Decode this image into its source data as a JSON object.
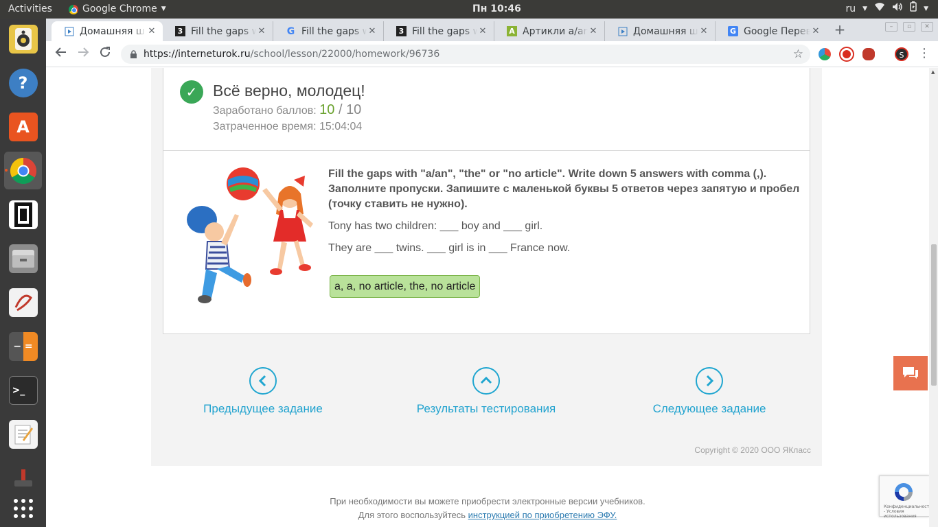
{
  "topbar": {
    "activities": "Activities",
    "app_name": "Google Chrome",
    "clock": "Пн 10:46",
    "keyboard_layout": "ru"
  },
  "dock": {
    "items": [
      {
        "name": "rhythmbox-icon",
        "color": "#e8c547"
      },
      {
        "name": "help-icon",
        "color": "#3d7fc4"
      },
      {
        "name": "software-center-icon",
        "color": "#e95420"
      },
      {
        "name": "chrome-icon",
        "color": "#4285f4"
      },
      {
        "name": "chess-icon",
        "color": "#111111"
      },
      {
        "name": "files-icon",
        "color": "#8d8d8d"
      },
      {
        "name": "document-viewer-icon",
        "color": "#eeeeee"
      },
      {
        "name": "calculator-icon",
        "color": "#f08a24"
      },
      {
        "name": "terminal-icon",
        "color": "#2b2b2b"
      },
      {
        "name": "text-editor-icon",
        "color": "#f4f4f4"
      },
      {
        "name": "joystick-icon",
        "color": "#444444"
      },
      {
        "name": "show-apps-icon",
        "color": "#3a3a3a"
      }
    ]
  },
  "tabs": [
    {
      "title": "Домашняя ш",
      "favicon": "play-doc-icon",
      "active": true
    },
    {
      "title": "Fill the gaps w",
      "favicon": "znanija-icon",
      "active": false
    },
    {
      "title": "Fill the gaps w",
      "favicon": "google-icon",
      "active": false
    },
    {
      "title": "Fill the gaps w",
      "favicon": "znanija-icon",
      "active": false
    },
    {
      "title": "Артикли a/an",
      "favicon": "android-icon",
      "active": false
    },
    {
      "title": "Домашняя ш",
      "favicon": "play-doc-icon",
      "active": false
    },
    {
      "title": "Google Перев",
      "favicon": "translate-icon",
      "active": false
    }
  ],
  "address_bar": {
    "host": "https://interneturok.ru",
    "path": "/school/lesson/22000/homework/96736"
  },
  "result": {
    "verdict": "Всё верно, молодец!",
    "score_label": "Заработано баллов:",
    "score_got": "10",
    "score_sep": " / ",
    "score_total": "10",
    "time_label": "Затраченное время:",
    "time_value": "15:04:04"
  },
  "task": {
    "instruction": "Fill the gaps with \"a/an\", \"the\" or \"no article\". Write down 5 answers with comma (,). Заполните пропуски. Запишите с маленькой буквы 5 ответов через запятую и пробел (точку ставить не нужно).",
    "sentences": [
      "Tony has two children: ___ boy and ___ girl.",
      "They are ___ twins. ___ girl is in ___ France now."
    ],
    "answer": "a, a, no article, the, no article",
    "image_caption": "http://kids-images.com/"
  },
  "navigation": {
    "prev": "Предыдущее задание",
    "results": "Результаты тестирования",
    "next": "Следующее задание"
  },
  "copyright": "Copyright © 2020 ООО ЯКласс",
  "footer": {
    "line1": "При необходимости вы можете приобрести электронные версии учебников.",
    "line2_prefix": "Для этого воспользуйтесь ",
    "line2_link": "инструкцией по приобретению ЭФУ."
  },
  "recaptcha": {
    "text": "Конфиденциальность - Условия использования"
  },
  "colors": {
    "success": "#3aa757",
    "score": "#6aa22e",
    "link": "#22a3cf",
    "answer_bg": "#b9e29a",
    "chat": "#e8724f"
  }
}
